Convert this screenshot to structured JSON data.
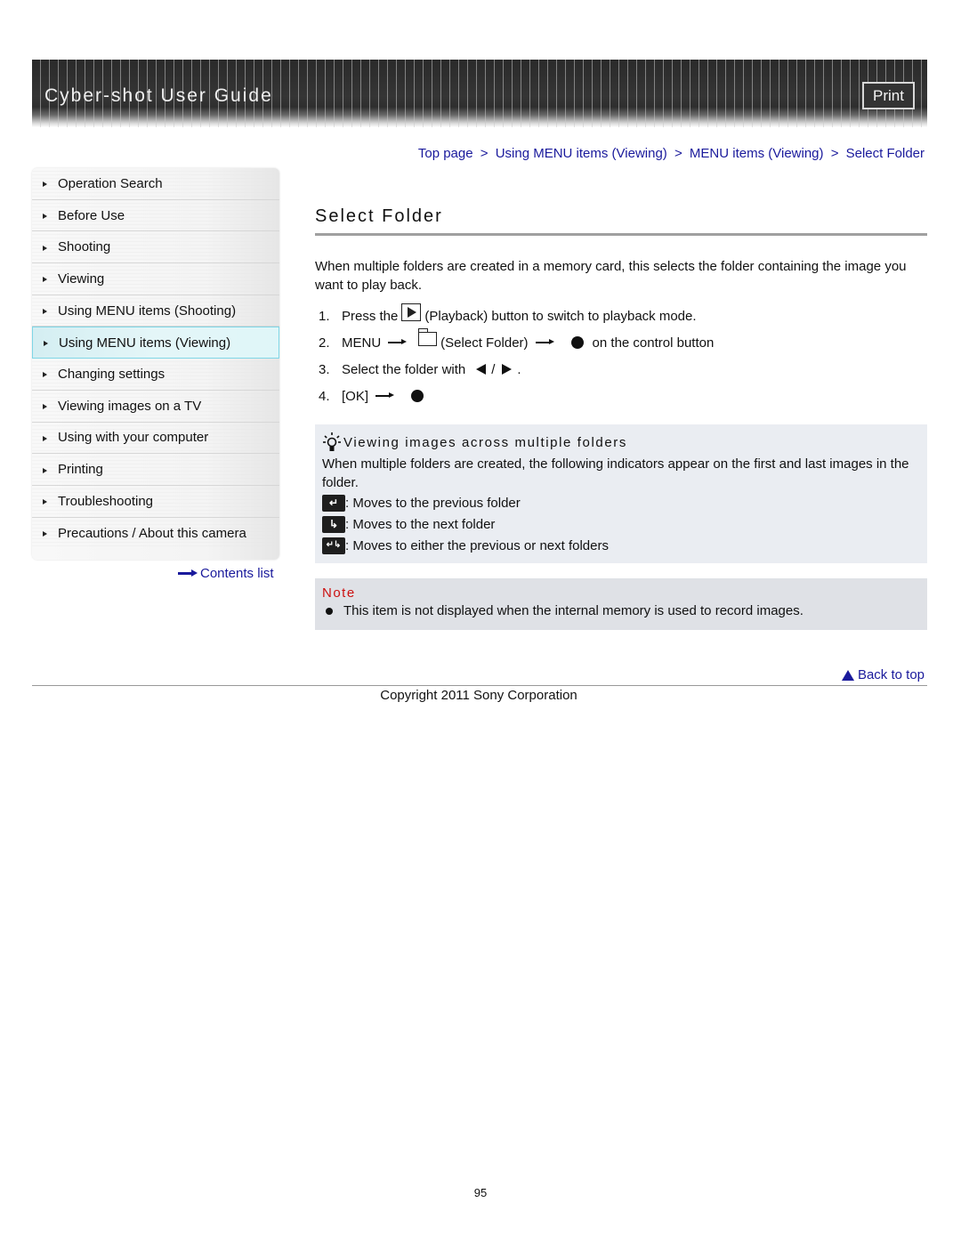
{
  "header": {
    "title": "Cyber-shot User Guide",
    "print_label": "Print"
  },
  "breadcrumb": [
    {
      "label": "Top page"
    },
    {
      "label": "Using MENU items (Viewing)"
    },
    {
      "label": "MENU items (Viewing)"
    },
    {
      "label": "Select Folder"
    }
  ],
  "breadcrumb_separator": ">",
  "sidebar": {
    "items": [
      {
        "label": "Operation Search",
        "active": false
      },
      {
        "label": "Before Use",
        "active": false
      },
      {
        "label": "Shooting",
        "active": false
      },
      {
        "label": "Viewing",
        "active": false
      },
      {
        "label": "Using MENU items (Shooting)",
        "active": false
      },
      {
        "label": "Using MENU items (Viewing)",
        "active": true
      },
      {
        "label": "Changing settings",
        "active": false
      },
      {
        "label": "Viewing images on a TV",
        "active": false
      },
      {
        "label": "Using with your computer",
        "active": false
      },
      {
        "label": "Printing",
        "active": false
      },
      {
        "label": "Troubleshooting",
        "active": false
      },
      {
        "label": "Precautions / About this camera",
        "active": false
      }
    ],
    "contents_link": "Contents list"
  },
  "main": {
    "title": "Select Folder",
    "intro": "When multiple folders are created in a memory card, this selects the folder containing the image you want to play back.",
    "steps": [
      {
        "num": "1.",
        "pre": "Press the",
        "icon": "playback-icon",
        "post": "(Playback) button to switch to playback mode."
      },
      {
        "num": "2.",
        "pre": "MENU",
        "icon": "folder-icon",
        "mid": "(Select Folder)",
        "post": "on the control button"
      },
      {
        "num": "3.",
        "pre": "Select the folder with",
        "sep": "/",
        "post": "."
      },
      {
        "num": "4.",
        "pre": "[OK]"
      }
    ],
    "hint": {
      "title": "Viewing images across multiple folders",
      "text": "When multiple folders are created, the following indicators appear on the first and last images in the folder.",
      "indicators": [
        {
          "icon": "previous-folder-icon",
          "glyph": "↵",
          "label": ": Moves to the previous folder"
        },
        {
          "icon": "next-folder-icon",
          "glyph": "↳",
          "label": ": Moves to the next folder"
        },
        {
          "icon": "either-folder-icon",
          "glyph": "↵↳",
          "label": ": Moves to either the previous or next folders"
        }
      ]
    },
    "note": {
      "title": "Note",
      "items": [
        "This item is not displayed when the internal memory is used to record images."
      ]
    }
  },
  "footer": {
    "back_to_top": "Back to top",
    "copyright": "Copyright 2011 Sony Corporation",
    "page_number": "95"
  },
  "colors": {
    "link": "#1a1a9c",
    "note_title": "#cc1111",
    "hint_bg": "#eaedf2",
    "note_bg": "#dfe1e6",
    "active_item_border": "#7fd6e6"
  }
}
